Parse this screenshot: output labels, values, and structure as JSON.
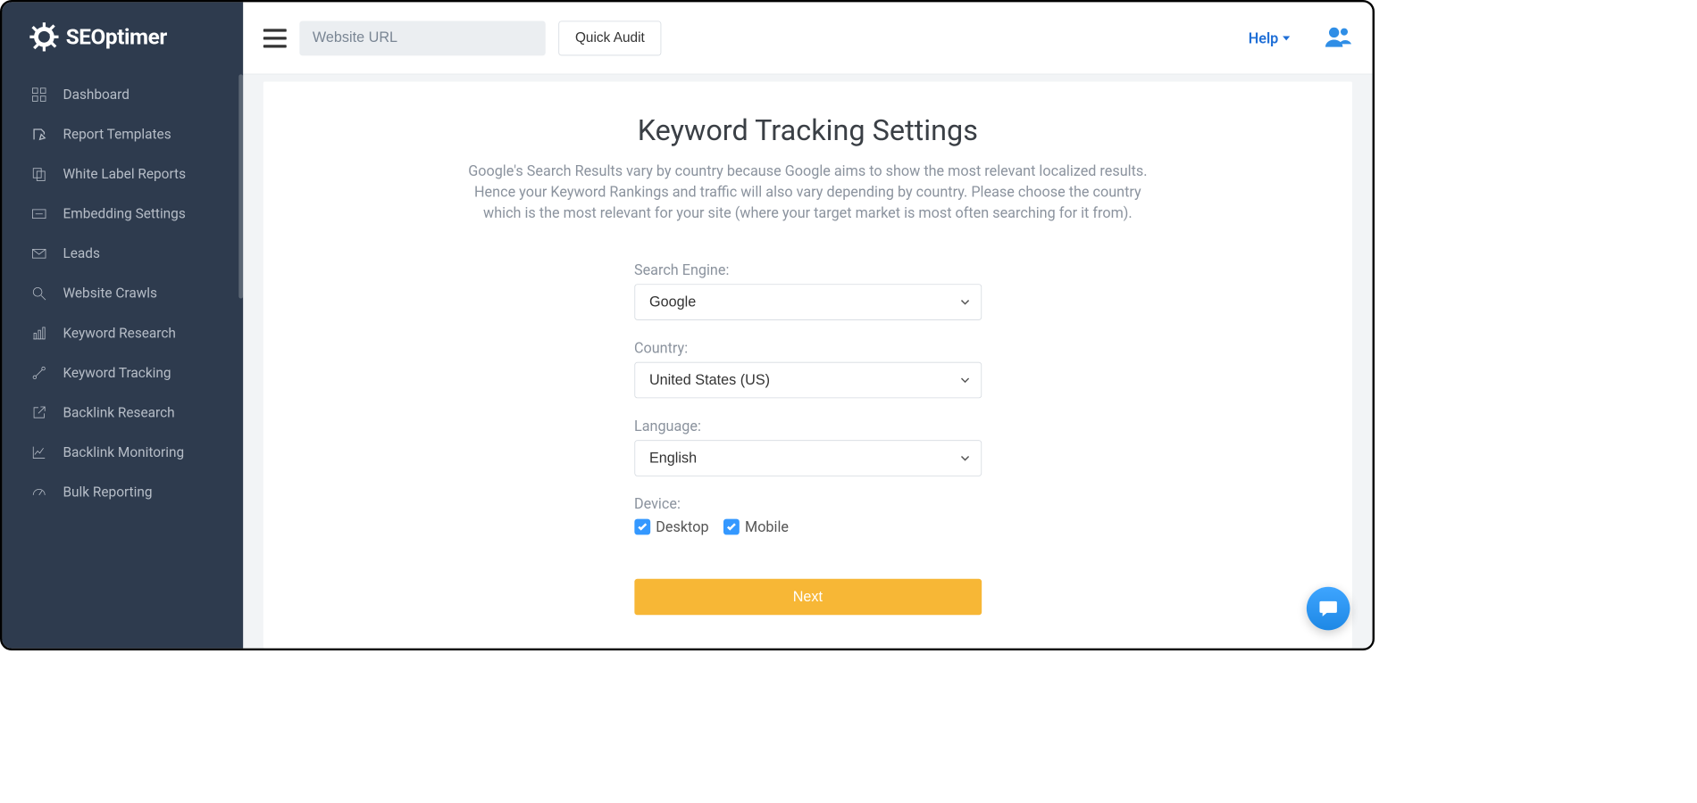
{
  "brand": {
    "name": "SEOptimer"
  },
  "sidebar": {
    "items": [
      {
        "label": "Dashboard"
      },
      {
        "label": "Report Templates"
      },
      {
        "label": "White Label Reports"
      },
      {
        "label": "Embedding Settings"
      },
      {
        "label": "Leads"
      },
      {
        "label": "Website Crawls"
      },
      {
        "label": "Keyword Research"
      },
      {
        "label": "Keyword Tracking"
      },
      {
        "label": "Backlink Research"
      },
      {
        "label": "Backlink Monitoring"
      },
      {
        "label": "Bulk Reporting"
      }
    ]
  },
  "topbar": {
    "url_placeholder": "Website URL",
    "quick_audit_label": "Quick Audit",
    "help_label": "Help"
  },
  "page": {
    "title": "Keyword Tracking Settings",
    "description": "Google's Search Results vary by country because Google aims to show the most relevant localized results. Hence your Keyword Rankings and traffic will also vary depending by country. Please choose the country which is the most relevant for your site (where your target market is most often searching for it from)."
  },
  "form": {
    "search_engine": {
      "label": "Search Engine:",
      "value": "Google"
    },
    "country": {
      "label": "Country:",
      "value": "United States (US)"
    },
    "language": {
      "label": "Language:",
      "value": "English"
    },
    "device": {
      "label": "Device:",
      "desktop": "Desktop",
      "mobile": "Mobile"
    },
    "next_label": "Next"
  }
}
